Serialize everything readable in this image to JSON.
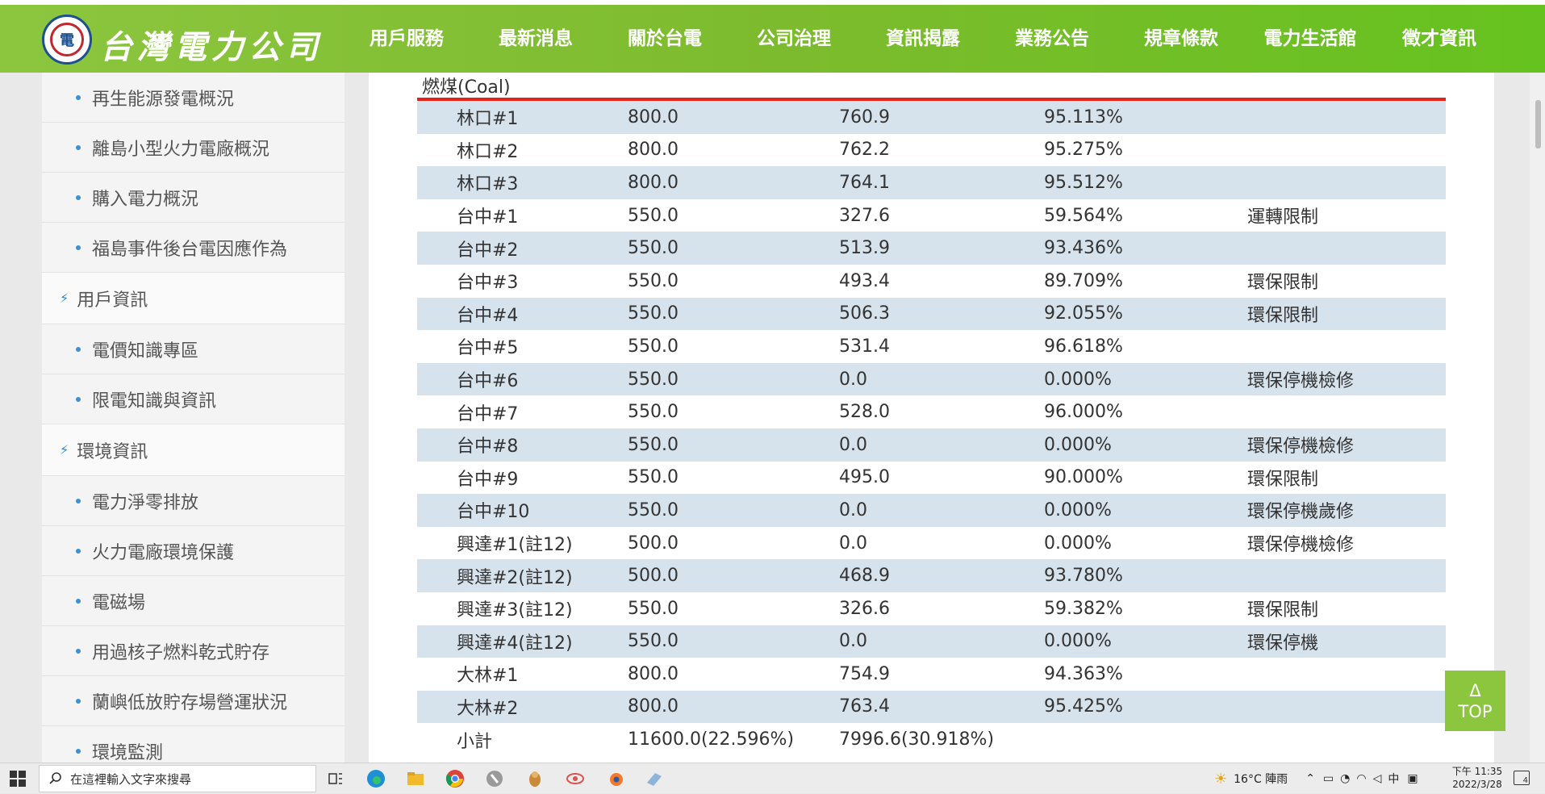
{
  "header": {
    "brand": "台灣電力公司",
    "logo_text": "電",
    "nav": [
      "用戶服務",
      "最新消息",
      "關於台電",
      "公司治理",
      "資訊揭露",
      "業務公告",
      "規章條款",
      "電力生活館",
      "徵才資訊"
    ]
  },
  "sidebar": {
    "items": [
      {
        "type": "sub",
        "label": "再生能源發電概況"
      },
      {
        "type": "sub",
        "label": "離島小型火力電廠概況"
      },
      {
        "type": "sub",
        "label": "購入電力概況"
      },
      {
        "type": "sub",
        "label": "福島事件後台電因應作為"
      },
      {
        "type": "cat",
        "label": "用戶資訊"
      },
      {
        "type": "sub",
        "label": "電價知識專區"
      },
      {
        "type": "sub",
        "label": "限電知識與資訊"
      },
      {
        "type": "cat",
        "label": "環境資訊"
      },
      {
        "type": "sub",
        "label": "電力淨零排放"
      },
      {
        "type": "sub",
        "label": "火力電廠環境保護"
      },
      {
        "type": "sub",
        "label": "電磁場"
      },
      {
        "type": "sub",
        "label": "用過核子燃料乾式貯存"
      },
      {
        "type": "sub",
        "label": "蘭嶼低放貯存場營運狀況"
      },
      {
        "type": "sub",
        "label": "環境監測"
      }
    ]
  },
  "section_title": "燃煤(Coal)",
  "table": {
    "rows": [
      [
        "林口#1",
        "800.0",
        "760.9",
        "95.113%",
        ""
      ],
      [
        "林口#2",
        "800.0",
        "762.2",
        "95.275%",
        ""
      ],
      [
        "林口#3",
        "800.0",
        "764.1",
        "95.512%",
        ""
      ],
      [
        "台中#1",
        "550.0",
        "327.6",
        "59.564%",
        "運轉限制"
      ],
      [
        "台中#2",
        "550.0",
        "513.9",
        "93.436%",
        ""
      ],
      [
        "台中#3",
        "550.0",
        "493.4",
        "89.709%",
        "環保限制"
      ],
      [
        "台中#4",
        "550.0",
        "506.3",
        "92.055%",
        "環保限制"
      ],
      [
        "台中#5",
        "550.0",
        "531.4",
        "96.618%",
        ""
      ],
      [
        "台中#6",
        "550.0",
        "0.0",
        "0.000%",
        "環保停機檢修"
      ],
      [
        "台中#7",
        "550.0",
        "528.0",
        "96.000%",
        ""
      ],
      [
        "台中#8",
        "550.0",
        "0.0",
        "0.000%",
        "環保停機檢修"
      ],
      [
        "台中#9",
        "550.0",
        "495.0",
        "90.000%",
        "環保限制"
      ],
      [
        "台中#10",
        "550.0",
        "0.0",
        "0.000%",
        "環保停機歲修"
      ],
      [
        "興達#1(註12)",
        "500.0",
        "0.0",
        "0.000%",
        "環保停機檢修"
      ],
      [
        "興達#2(註12)",
        "500.0",
        "468.9",
        "93.780%",
        ""
      ],
      [
        "興達#3(註12)",
        "550.0",
        "326.6",
        "59.382%",
        "環保限制"
      ],
      [
        "興達#4(註12)",
        "550.0",
        "0.0",
        "0.000%",
        "環保停機"
      ],
      [
        "大林#1",
        "800.0",
        "754.9",
        "94.363%",
        ""
      ],
      [
        "大林#2",
        "800.0",
        "763.4",
        "95.425%",
        ""
      ],
      [
        "小計",
        "11600.0(22.596%)",
        "7996.6(30.918%)",
        "",
        ""
      ]
    ]
  },
  "top_button": {
    "arrow": "Δ",
    "label": "TOP"
  },
  "taskbar": {
    "search_placeholder": "在這裡輸入文字來搜尋",
    "weather": "16°C 陣雨",
    "ime": "中",
    "time": "下午 11:35",
    "date": "2022/3/28",
    "notification_count": "4"
  },
  "colors": {
    "header_green": "#7dbb2e",
    "accent_red": "#e2231a",
    "row_stripe": "#d7e3ec",
    "link_blue": "#3f8fd2"
  }
}
